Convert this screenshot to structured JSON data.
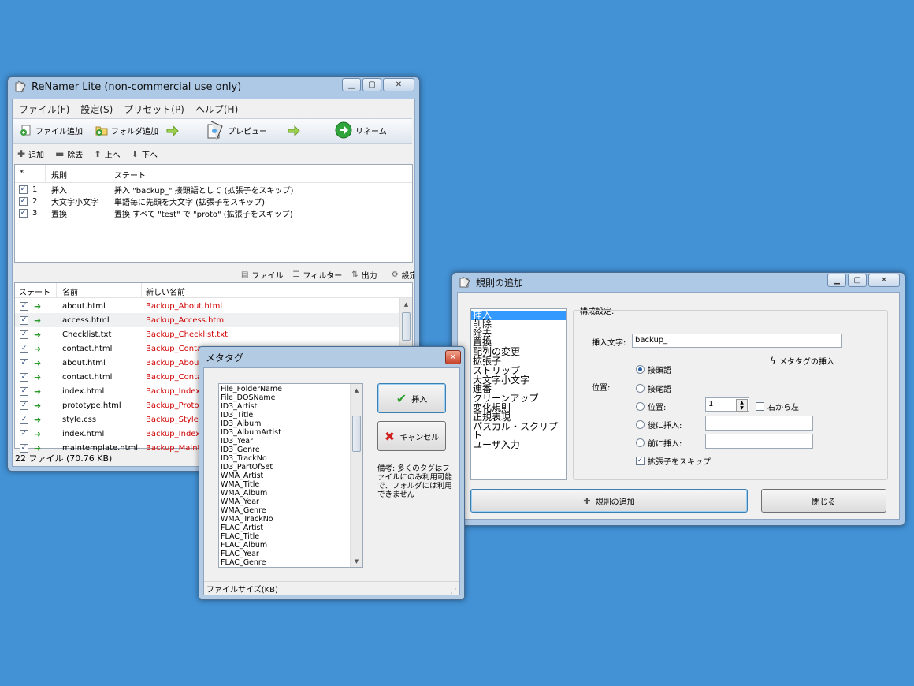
{
  "main": {
    "title": "ReNamer Lite (non-commercial use only)",
    "menu": [
      "ファイル(F)",
      "設定(S)",
      "プリセット(P)",
      "ヘルプ(H)"
    ],
    "toolbar": {
      "add_files": "ファイル追加",
      "add_folders": "フォルダ追加",
      "preview": "プレビュー",
      "rename": "リネーム"
    },
    "rules_toolbar": {
      "add": "追加",
      "remove": "除去",
      "up": "上へ",
      "down": "下へ"
    },
    "rules_columns": [
      "*",
      "規則",
      "ステート"
    ],
    "rules": [
      {
        "num": "1",
        "rule": "挿入",
        "state": "挿入 \"backup_\" 接頭語として (拡張子をスキップ)"
      },
      {
        "num": "2",
        "rule": "大文字小文字",
        "state": "単語毎に先頭を大文字 (拡張子をスキップ)"
      },
      {
        "num": "3",
        "rule": "置換",
        "state": "置換 すべて \"test\" で \"proto\" (拡張子をスキップ)"
      }
    ],
    "files_toolbar": {
      "files": "ファイル",
      "filter": "フィルター",
      "export": "出力",
      "settings": "設定"
    },
    "files_columns": [
      "ステート",
      "名前",
      "新しい名前"
    ],
    "files": [
      {
        "name": "about.html",
        "new_name": "Backup_About.html"
      },
      {
        "name": "access.html",
        "new_name": "Backup_Access.html"
      },
      {
        "name": "Checklist.txt",
        "new_name": "Backup_Checklist.txt"
      },
      {
        "name": "contact.html",
        "new_name": "Backup_Conta"
      },
      {
        "name": "about.html",
        "new_name": "Backup_About"
      },
      {
        "name": "contact.html",
        "new_name": "Backup_Conta"
      },
      {
        "name": "index.html",
        "new_name": "Backup_Index."
      },
      {
        "name": "prototype.html",
        "new_name": "Backup_Protot"
      },
      {
        "name": "style.css",
        "new_name": "Backup_Style.c"
      },
      {
        "name": "index.html",
        "new_name": "Backup_Index."
      },
      {
        "name": "maintemplate.html",
        "new_name": "Backup_Mainte"
      }
    ],
    "status": "22 ファイル (70.76 KB)"
  },
  "meta": {
    "title": "メタタグ",
    "tags": [
      "File_FolderName",
      "File_DOSName",
      "ID3_Artist",
      "ID3_Title",
      "ID3_Album",
      "ID3_AlbumArtist",
      "ID3_Year",
      "ID3_Genre",
      "ID3_TrackNo",
      "ID3_PartOfSet",
      "WMA_Artist",
      "WMA_Title",
      "WMA_Album",
      "WMA_Year",
      "WMA_Genre",
      "WMA_TrackNo",
      "FLAC_Artist",
      "FLAC_Title",
      "FLAC_Album",
      "FLAC_Year",
      "FLAC_Genre"
    ],
    "insert": "挿入",
    "cancel": "キャンセル",
    "note": "備考: 多くのタグはファイルにのみ利用可能で、フォルダには利用できません",
    "status": "ファイルサイズ(KB)"
  },
  "addrule": {
    "title": "規則の追加",
    "rules": [
      "挿入",
      "削除",
      "除去",
      "置換",
      "配列の変更",
      "拡張子",
      "ストリップ",
      "大文字小文字",
      "連番",
      "クリーンアップ",
      "変化規則",
      "正規表現",
      "パスカル・スクリプト",
      "ユーザ入力"
    ],
    "config_label": "構成設定:",
    "insert_label": "挿入文字:",
    "insert_value": "backup_",
    "meta_insert": "メタタグの挿入",
    "position_label": "位置:",
    "opt_prefix": "接頭語",
    "opt_suffix": "接尾語",
    "opt_position": "位置:",
    "position_value": "1",
    "right_to_left": "右から左",
    "opt_after": "後に挿入:",
    "opt_before": "前に挿入:",
    "skip_ext": "拡張子をスキップ",
    "add_button": "規則の追加",
    "close_button": "閉じる"
  }
}
